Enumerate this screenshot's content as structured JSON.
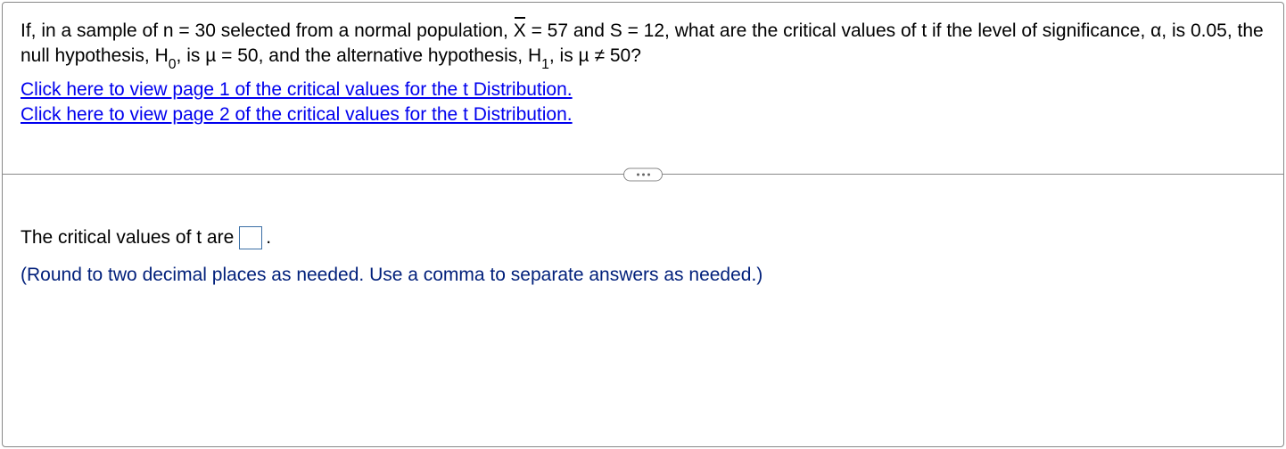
{
  "question": {
    "intro": "If, in a sample of n = 30 selected from a normal population, ",
    "xbar_label": "X",
    "xbar_value": " = 57 and S = 12, what are the critical values of t if the level of significance, α, is 0.05, the null hypothesis, H",
    "h0_sub": "0",
    "h0_rest": ", is µ = 50, and the alternative hypothesis, H",
    "h1_sub": "1",
    "h1_rest": ", is µ ≠ 50?"
  },
  "links": {
    "page1": "Click here to view page 1 of the critical values for the t Distribution.",
    "page2": "Click here to view page 2 of the critical values for the t Distribution."
  },
  "answer": {
    "prefix": "The critical values of t are ",
    "suffix": ".",
    "instruction": "(Round to two decimal places as needed. Use a comma to separate answers as needed.)"
  }
}
